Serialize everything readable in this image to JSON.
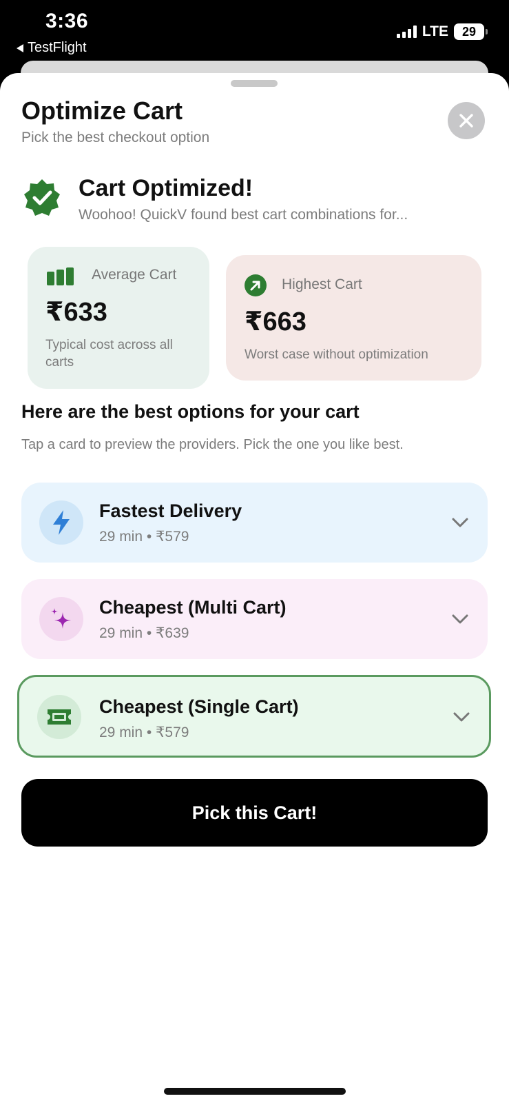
{
  "status_bar": {
    "time": "3:36",
    "back_label": "TestFlight",
    "network": "LTE",
    "battery": "29"
  },
  "sheet": {
    "title": "Optimize Cart",
    "subtitle": "Pick the best checkout option"
  },
  "optimized": {
    "title": "Cart Optimized!",
    "description": "Woohoo! QuickV found best cart combinations for..."
  },
  "stats": {
    "average": {
      "label": "Average Cart",
      "value": "₹633",
      "note": "Typical cost across all carts"
    },
    "highest": {
      "label": "Highest Cart",
      "value": "₹663",
      "note": "Worst case without optimization"
    }
  },
  "options_section": {
    "title": "Here are the best options for your cart",
    "subtitle": "Tap a card to preview the providers. Pick the one you like best."
  },
  "options": [
    {
      "name": "Fastest Delivery",
      "meta": "29 min • ₹579",
      "icon": "lightning-icon",
      "selected": false
    },
    {
      "name": "Cheapest (Multi Cart)",
      "meta": "29 min • ₹639",
      "icon": "sparkles-icon",
      "selected": false
    },
    {
      "name": "Cheapest (Single Cart)",
      "meta": "29 min • ₹579",
      "icon": "ticket-icon",
      "selected": true
    }
  ],
  "cta": {
    "label": "Pick this Cart!"
  },
  "colors": {
    "accent_green": "#2e7d32",
    "selected_border": "#5a9a5f",
    "lightning_blue": "#2f7fd6",
    "sparkle_purple": "#9c27b0"
  }
}
